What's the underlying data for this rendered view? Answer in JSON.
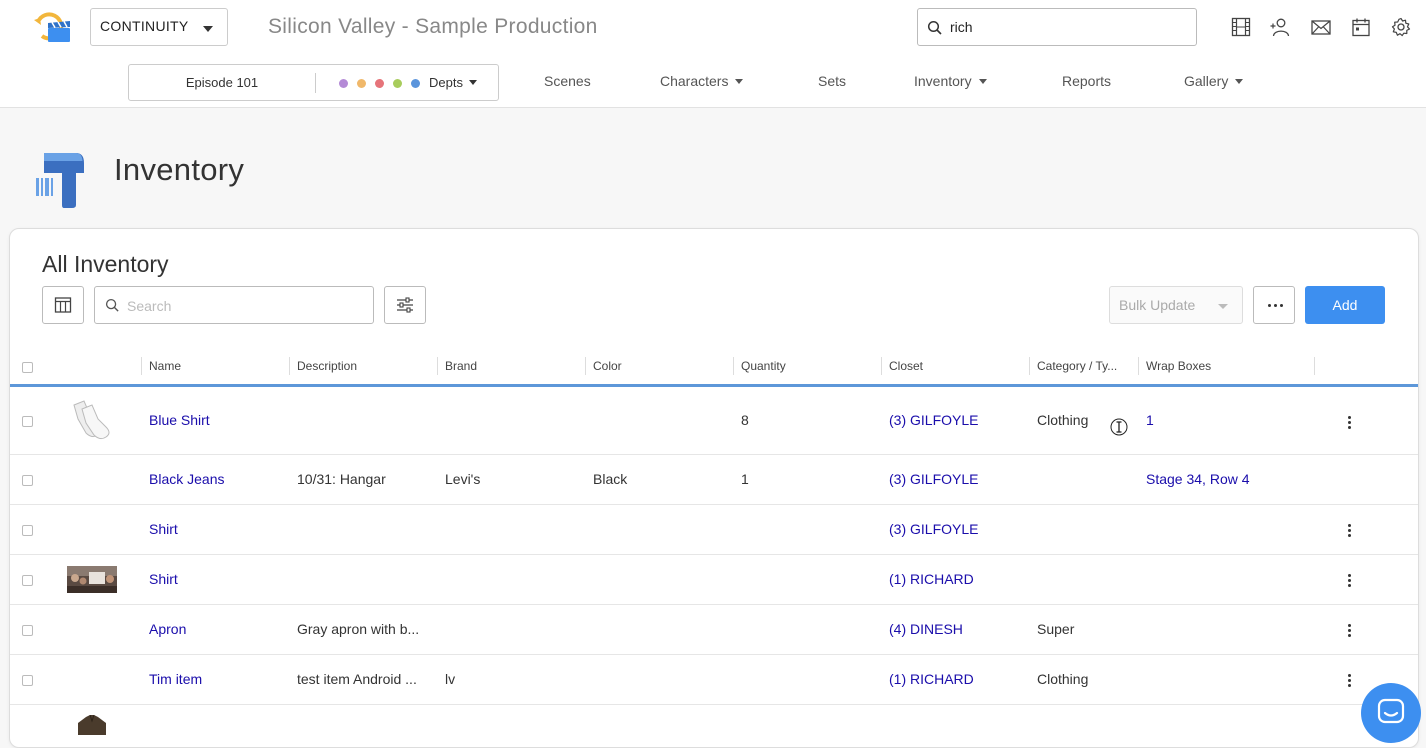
{
  "header": {
    "production_selector": "CONTINUITY",
    "production_title": "Silicon Valley - Sample Production",
    "search_value": "rich",
    "icons": [
      "film-icon",
      "add-person-icon",
      "mail-icon",
      "calendar-icon",
      "gear-icon"
    ]
  },
  "subnav": {
    "episode": "Episode 101",
    "dept_dots": [
      "#b48ad6",
      "#f0b86a",
      "#e6747a",
      "#a8cc5c",
      "#5b95dc"
    ],
    "depts_label": "Depts",
    "links": [
      {
        "label": "Scenes",
        "caret": false
      },
      {
        "label": "Characters",
        "caret": true
      },
      {
        "label": "Sets",
        "caret": false
      },
      {
        "label": "Inventory",
        "caret": true
      },
      {
        "label": "Reports",
        "caret": false
      },
      {
        "label": "Gallery",
        "caret": true
      }
    ]
  },
  "page": {
    "title": "Inventory",
    "icon": "barcode-scanner-icon"
  },
  "card": {
    "title": "All Inventory",
    "search_placeholder": "Search",
    "bulk_update_label": "Bulk Update",
    "add_label": "Add"
  },
  "table": {
    "columns": [
      "Name",
      "Description",
      "Brand",
      "Color",
      "Quantity",
      "Closet",
      "Category / Ty...",
      "Wrap Boxes"
    ],
    "rows": [
      {
        "thumb": "socks",
        "name": "Blue Shirt",
        "description": "",
        "brand": "",
        "color": "",
        "quantity": "8",
        "closet": "(3) GILFOYLE",
        "category": "Clothing",
        "wrap_boxes": "1"
      },
      {
        "thumb": "",
        "name": "Black Jeans",
        "description": "10/31: Hangar",
        "brand": "Levi's",
        "color": "Black",
        "quantity": "1",
        "closet": "(3) GILFOYLE",
        "category": "",
        "wrap_boxes": "Stage 34, Row 4"
      },
      {
        "thumb": "",
        "name": "Shirt",
        "description": "",
        "brand": "",
        "color": "",
        "quantity": "",
        "closet": "(3) GILFOYLE",
        "category": "",
        "wrap_boxes": ""
      },
      {
        "thumb": "photo",
        "name": "Shirt",
        "description": "",
        "brand": "",
        "color": "",
        "quantity": "",
        "closet": "(1) RICHARD",
        "category": "",
        "wrap_boxes": ""
      },
      {
        "thumb": "",
        "name": "Apron",
        "description": "Gray apron with b...",
        "brand": "",
        "color": "",
        "quantity": "",
        "closet": "(4) DINESH",
        "category": "Super",
        "wrap_boxes": ""
      },
      {
        "thumb": "",
        "name": "Tim item",
        "description": "test item Android ...",
        "brand": "lv",
        "color": "",
        "quantity": "",
        "closet": "(1) RICHARD",
        "category": "Clothing",
        "wrap_boxes": ""
      },
      {
        "thumb": "jacket",
        "name": "",
        "description": "",
        "brand": "",
        "color": "",
        "quantity": "",
        "closet": "",
        "category": "",
        "wrap_boxes": ""
      }
    ]
  },
  "colors": {
    "accent": "#3d8ff0",
    "link": "#1a0dab",
    "header_underline": "#5d97d9"
  }
}
